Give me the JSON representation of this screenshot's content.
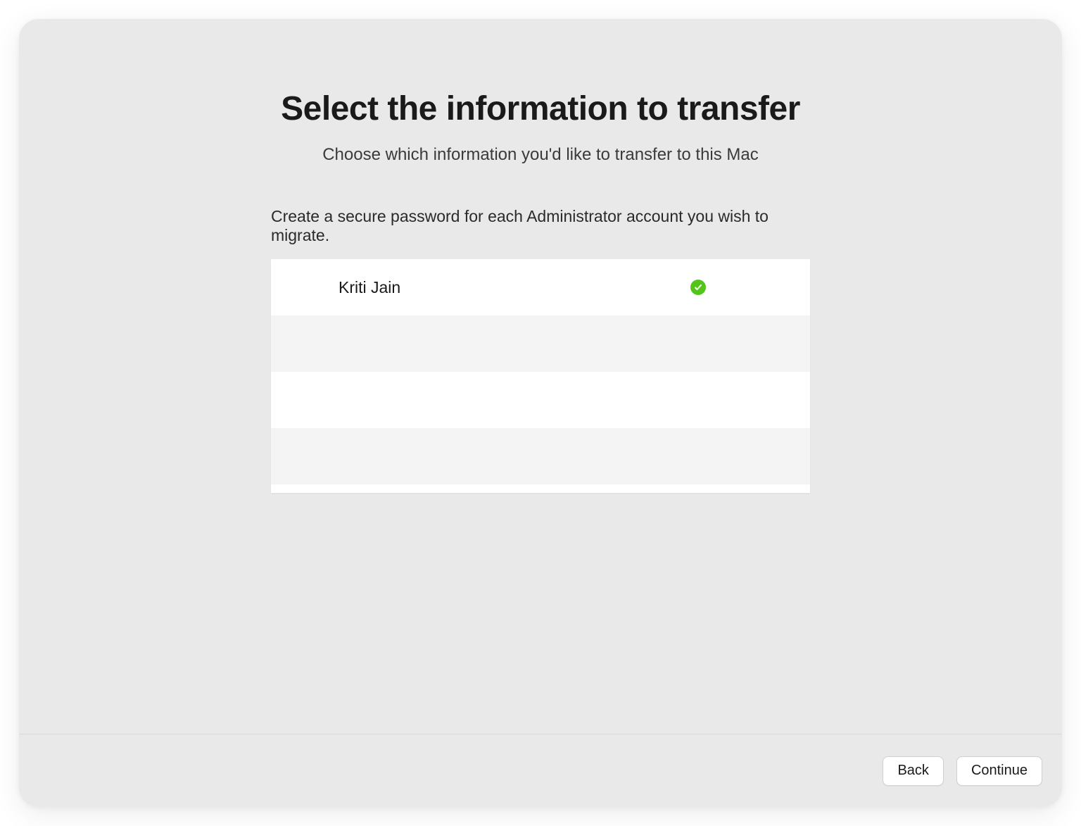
{
  "header": {
    "title": "Select the information to transfer",
    "subtitle": "Choose which information you'd like to transfer to this Mac"
  },
  "instruction": "Create a secure password for each Administrator account you wish to migrate.",
  "accounts": [
    {
      "name": "Kriti Jain",
      "verified": true
    }
  ],
  "footer": {
    "back": "Back",
    "continue": "Continue"
  }
}
